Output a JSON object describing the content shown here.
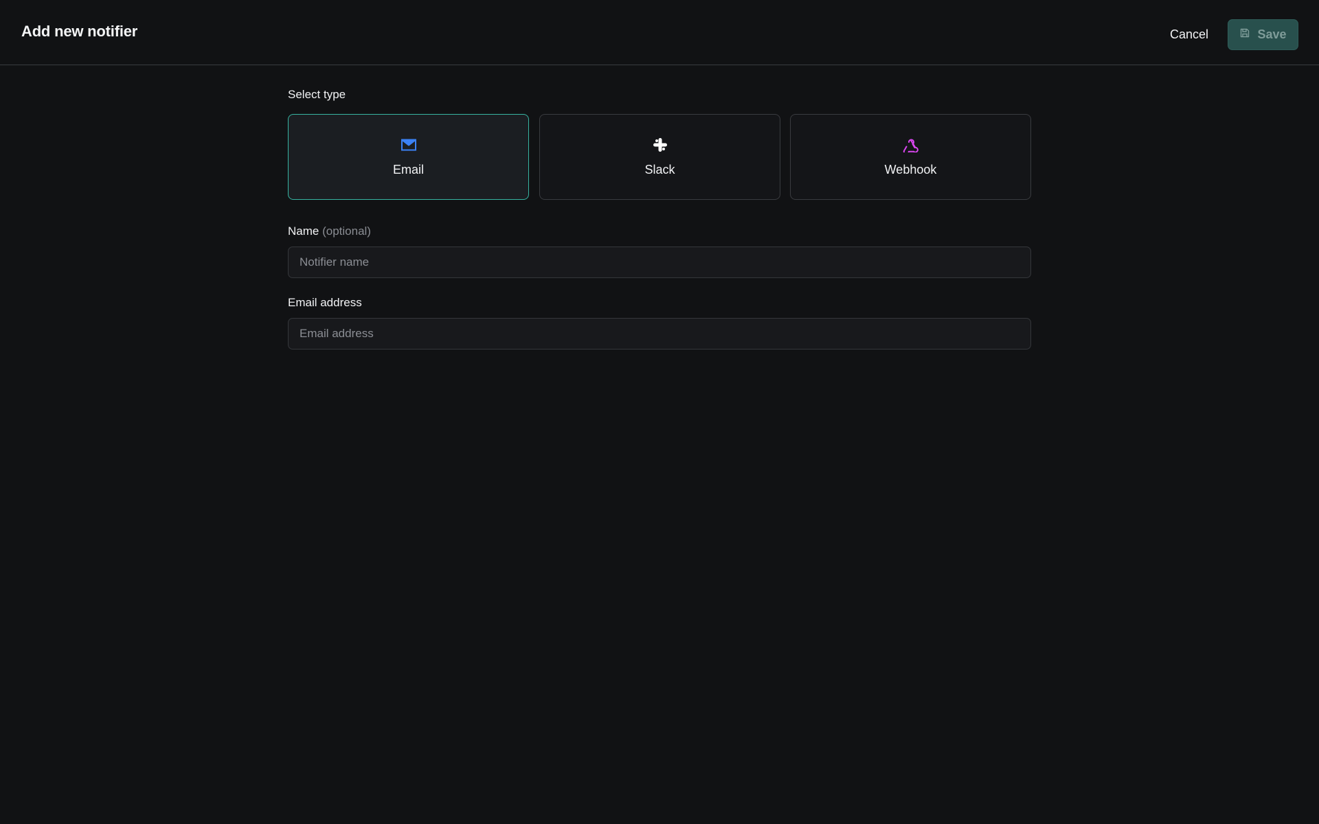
{
  "header": {
    "title": "Add new notifier",
    "cancel_label": "Cancel",
    "save_label": "Save",
    "save_icon": "floppy-disk-icon"
  },
  "type_section": {
    "label": "Select type",
    "selected": "Email",
    "options": [
      {
        "label": "Email",
        "icon": "envelope-icon",
        "icon_color": "#3b82f6"
      },
      {
        "label": "Slack",
        "icon": "slack-icon",
        "icon_color": "#ffffff"
      },
      {
        "label": "Webhook",
        "icon": "webhook-icon",
        "icon_color": "#d946ef"
      }
    ]
  },
  "name_field": {
    "label": "Name",
    "optional_label": "(optional)",
    "value": "",
    "placeholder": "Notifier name"
  },
  "email_field": {
    "label": "Email address",
    "value": "",
    "placeholder": "Email address"
  },
  "colors": {
    "background": "#111214",
    "accent_border": "#37b5a3",
    "save_button_bg": "#28504d"
  }
}
